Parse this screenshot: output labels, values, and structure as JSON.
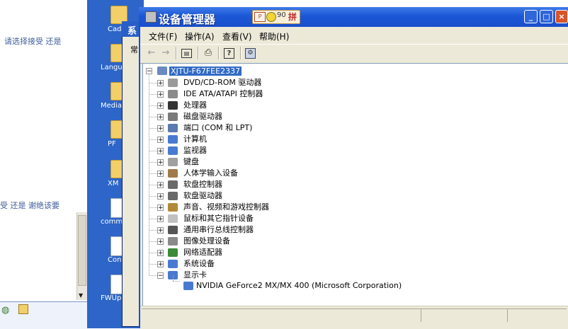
{
  "left_panel": {
    "text1": "请选择接受 还是",
    "text2": "受 还是 谢绝该要"
  },
  "desktop_icons": [
    {
      "label": "Cad",
      "kind": "folder"
    },
    {
      "label": "Langu",
      "kind": "folder"
    },
    {
      "label": "Media",
      "kind": "folder"
    },
    {
      "label": "PF",
      "kind": "folder"
    },
    {
      "label": "XM",
      "kind": "folder"
    },
    {
      "label": "commo",
      "kind": "doc"
    },
    {
      "label": "Conf",
      "kind": "doc"
    },
    {
      "label": "FWUpr",
      "kind": "doc"
    }
  ],
  "behind_dialog": {
    "title_fragment": "系",
    "tab_fragment": "常"
  },
  "window": {
    "title": "设备管理器",
    "badge_text": "90",
    "badge_char": "拼",
    "controls": {
      "minimize": "_",
      "maximize": "□",
      "close": "×"
    }
  },
  "menu": {
    "file": "文件(F)",
    "action": "操作(A)",
    "view": "查看(V)",
    "help": "帮助(H)"
  },
  "toolbar": {
    "back": "back-icon",
    "forward": "forward-icon",
    "properties": "properties-icon",
    "print": "print-icon",
    "help": "help-icon",
    "scan": "scan-icon"
  },
  "tree": {
    "root": "XJTU-F67FEE2337",
    "categories": [
      {
        "label": "DVD/CD-ROM 驱动器",
        "icon": "cdrom-icon",
        "color": "#9a9a9a"
      },
      {
        "label": "IDE ATA/ATAPI 控制器",
        "icon": "ide-controller-icon",
        "color": "#8a8a8a"
      },
      {
        "label": "处理器",
        "icon": "processor-icon",
        "color": "#333333"
      },
      {
        "label": "磁盘驱动器",
        "icon": "disk-drive-icon",
        "color": "#7a7a7a"
      },
      {
        "label": "端口 (COM 和 LPT)",
        "icon": "port-icon",
        "color": "#5a7ab0"
      },
      {
        "label": "计算机",
        "icon": "computer-icon",
        "color": "#4a7ad0"
      },
      {
        "label": "监视器",
        "icon": "monitor-icon",
        "color": "#4a7ad0"
      },
      {
        "label": "键盘",
        "icon": "keyboard-icon",
        "color": "#a0a0a0"
      },
      {
        "label": "人体学输入设备",
        "icon": "hid-icon",
        "color": "#a07a4a"
      },
      {
        "label": "软盘控制器",
        "icon": "floppy-controller-icon",
        "color": "#6a6a6a"
      },
      {
        "label": "软盘驱动器",
        "icon": "floppy-drive-icon",
        "color": "#6a6a6a"
      },
      {
        "label": "声音、视频和游戏控制器",
        "icon": "sound-icon",
        "color": "#b08a3a"
      },
      {
        "label": "鼠标和其它指针设备",
        "icon": "mouse-icon",
        "color": "#c0c0c0"
      },
      {
        "label": "通用串行总线控制器",
        "icon": "usb-icon",
        "color": "#555555"
      },
      {
        "label": "图像处理设备",
        "icon": "imaging-icon",
        "color": "#8a8a8a"
      },
      {
        "label": "网络适配器",
        "icon": "network-adapter-icon",
        "color": "#3a8a3a"
      },
      {
        "label": "系统设备",
        "icon": "system-device-icon",
        "color": "#4a7ad0"
      },
      {
        "label": "显示卡",
        "icon": "display-adapter-icon",
        "color": "#4a7ad0"
      }
    ],
    "child": "NVIDIA GeForce2 MX/MX 400 (Microsoft Corporation)"
  }
}
